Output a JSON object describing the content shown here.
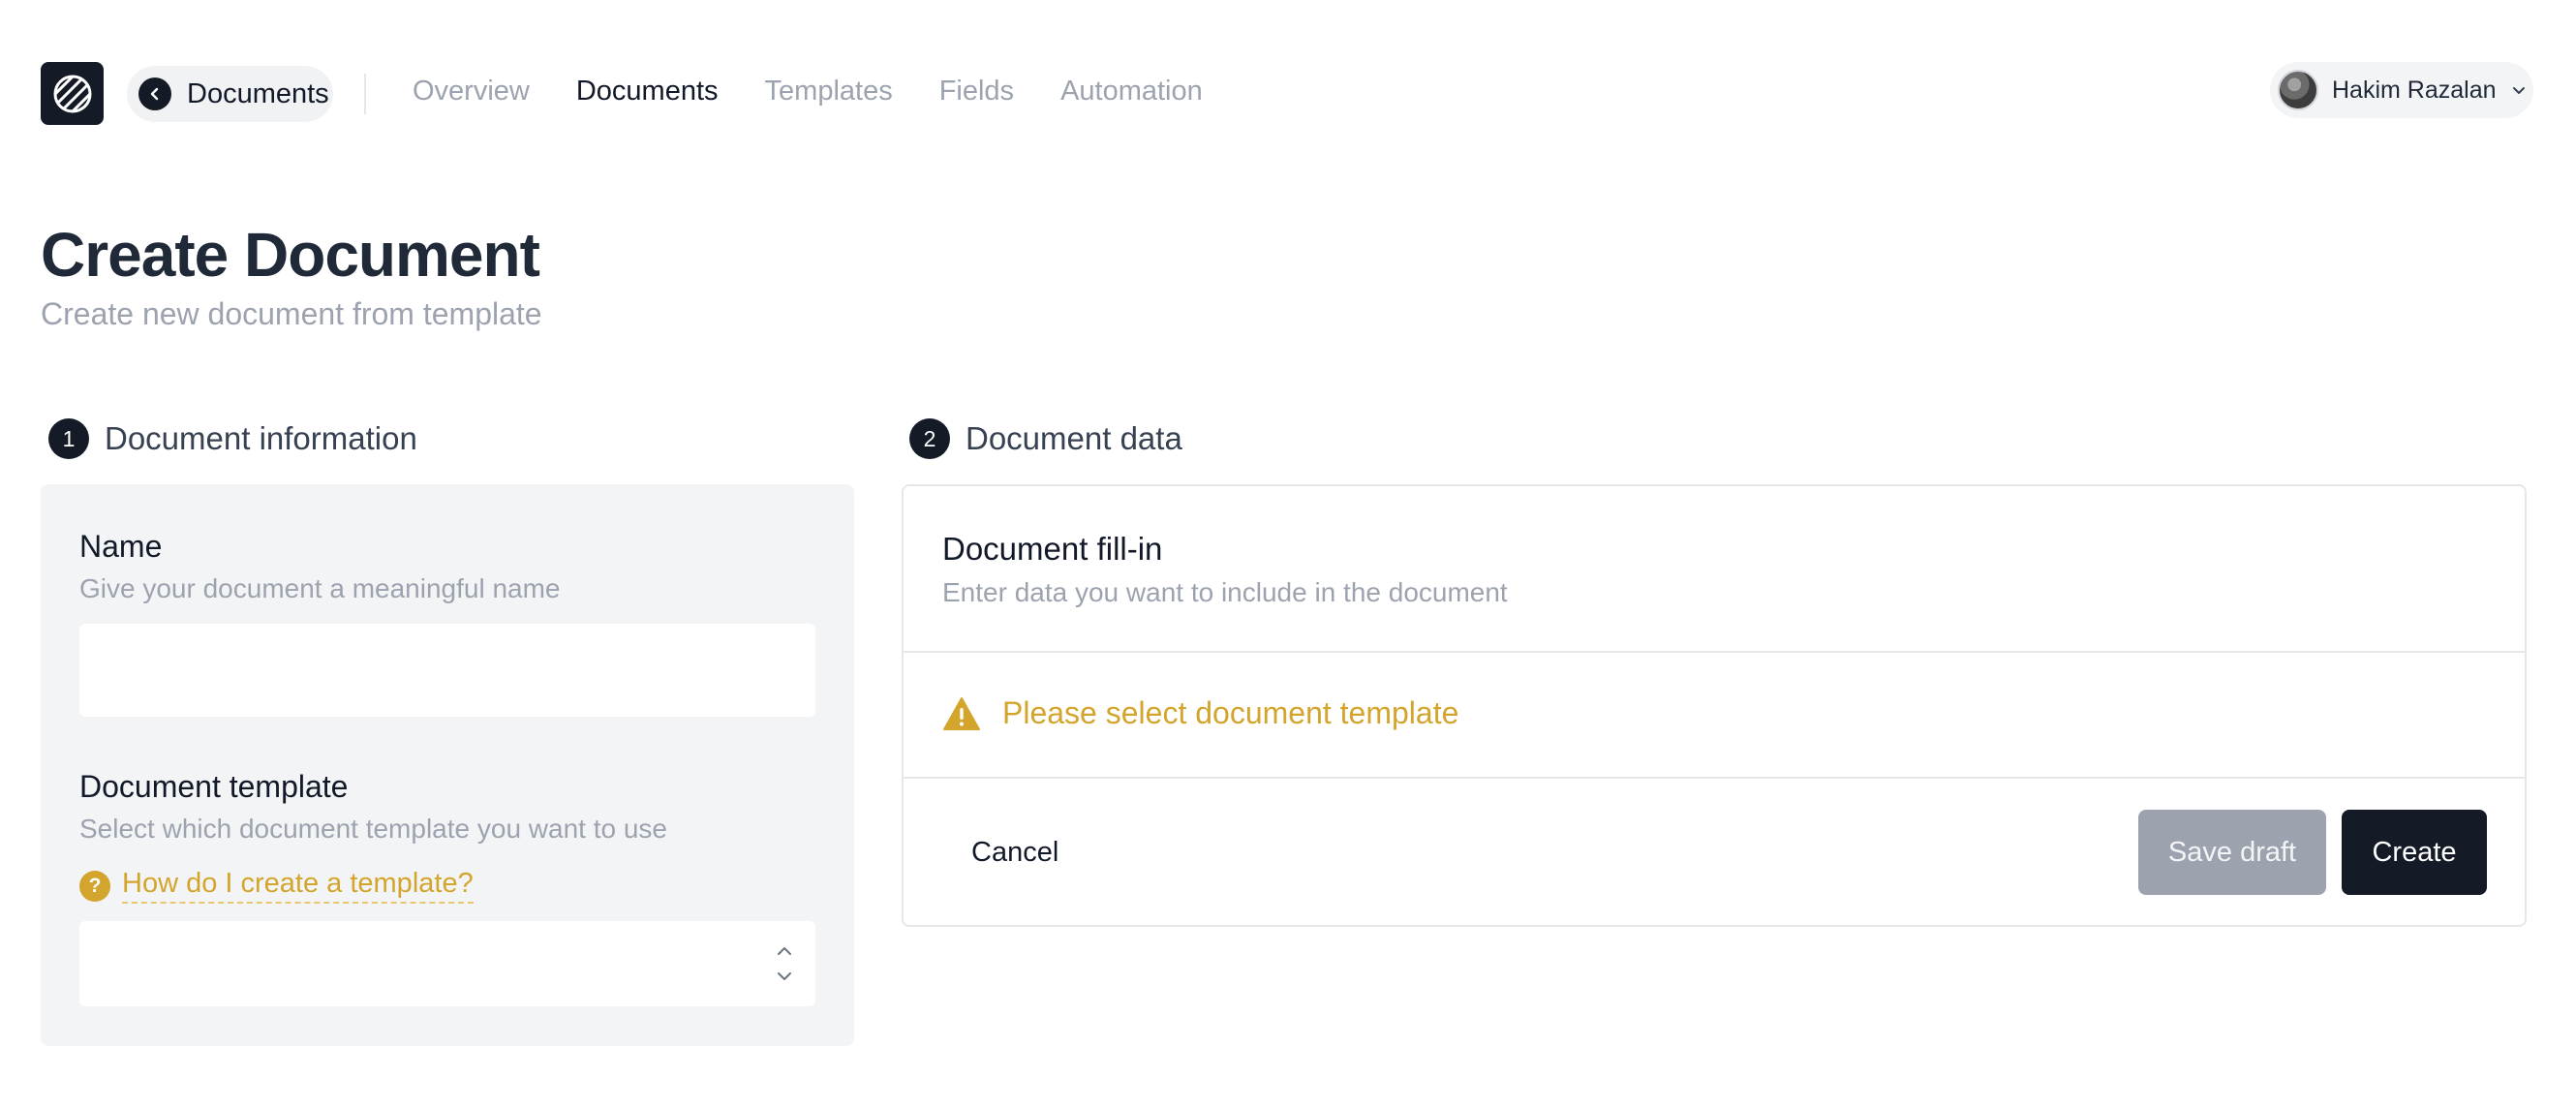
{
  "header": {
    "logo_icon": "striped-logo-icon",
    "back_button_label": "Documents",
    "nav": [
      {
        "label": "Overview",
        "active": false
      },
      {
        "label": "Documents",
        "active": true
      },
      {
        "label": "Templates",
        "active": false
      },
      {
        "label": "Fields",
        "active": false
      },
      {
        "label": "Automation",
        "active": false
      }
    ],
    "user": {
      "name": "Hakim Razalan"
    }
  },
  "page": {
    "title": "Create Document",
    "subtitle": "Create new document from template"
  },
  "steps": [
    {
      "number": "1",
      "title": "Document information"
    },
    {
      "number": "2",
      "title": "Document data"
    }
  ],
  "form": {
    "name": {
      "label": "Name",
      "description": "Give your document a meaningful name",
      "value": "",
      "placeholder": ""
    },
    "template": {
      "label": "Document template",
      "description": "Select which document template you want to use",
      "help_icon": "?",
      "help_link": "How do I create a template?",
      "selected_value": ""
    }
  },
  "fill_in": {
    "title": "Document fill-in",
    "description": "Enter data you want to include in the document",
    "warning": "Please select document template"
  },
  "actions": {
    "cancel": "Cancel",
    "save_draft": "Save draft",
    "create": "Create"
  },
  "colors": {
    "primary": "#141a26",
    "warning": "#d4a52c",
    "muted": "#9ca3af"
  }
}
